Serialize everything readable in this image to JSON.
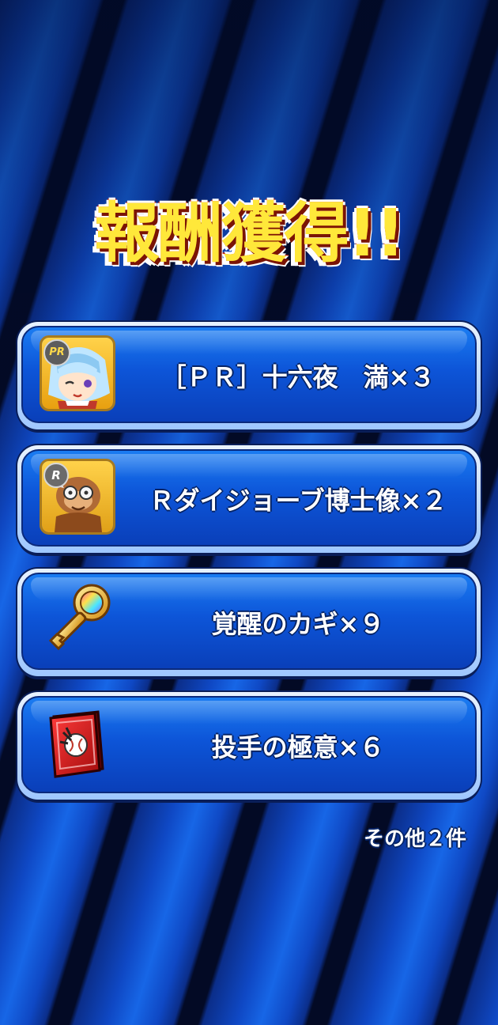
{
  "title": "報酬獲得!!",
  "rewards": [
    {
      "label": "［ＰＲ］十六夜　満×３",
      "icon": "character-card-pr-icon",
      "badge": "PR"
    },
    {
      "label": "Ｒダイジョーブ博士像×２",
      "icon": "doctor-statue-card-icon",
      "badge": "R"
    },
    {
      "label": "覚醒のカギ×９",
      "icon": "awakening-key-icon"
    },
    {
      "label": "投手の極意×６",
      "icon": "pitcher-secret-book-icon"
    }
  ],
  "footer_note": "その他２件",
  "colors": {
    "title_fill": "#ffe83a",
    "title_outline": "#c8280e",
    "button_blue": "#0d55d8",
    "background_blue": "#0f48c4"
  }
}
